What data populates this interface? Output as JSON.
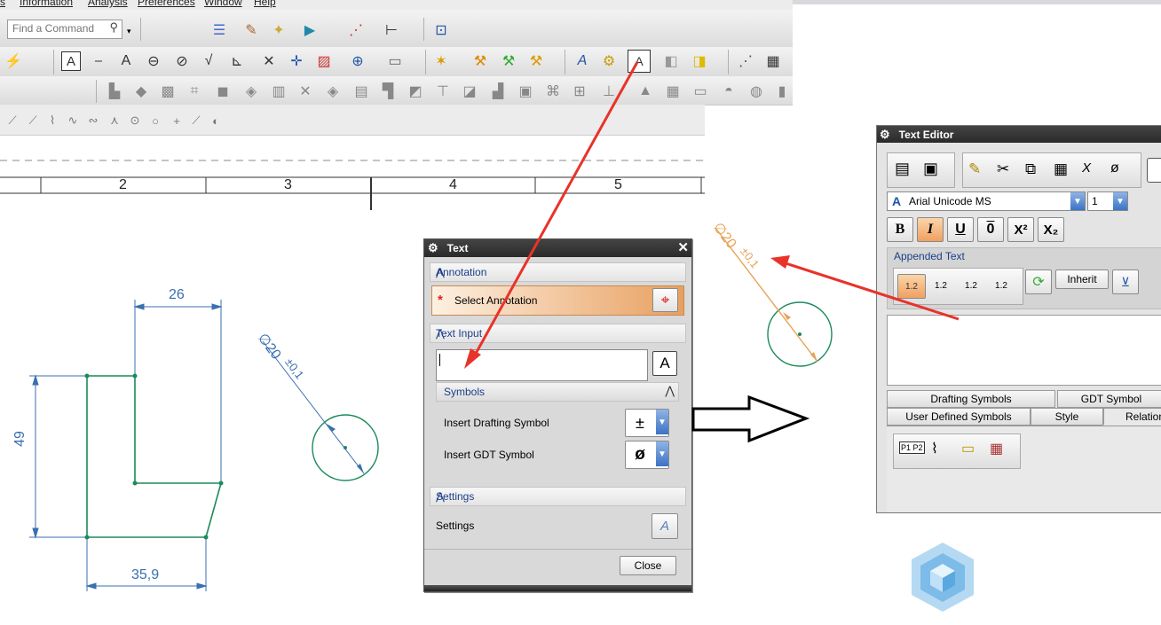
{
  "menu": {
    "items": [
      "s",
      "Information",
      "Analysis",
      "Preferences",
      "Window",
      "Help"
    ]
  },
  "search": {
    "placeholder": "Find a Command"
  },
  "ruler": {
    "numbers": [
      "2",
      "3",
      "4",
      "5"
    ]
  },
  "drawing": {
    "dim_top": "26",
    "dim_left": "49",
    "dim_bottom": "35,9",
    "note_diameter": "∅20",
    "note_tolerance": "±0,1"
  },
  "text_dialog": {
    "title": "Text",
    "sections": {
      "annotation": "Annotation",
      "select_annotation": "Select Annotation",
      "text_input": "Text Input",
      "symbols": "Symbols",
      "insert_drafting_symbol": "Insert Drafting Symbol",
      "insert_gdt_symbol": "Insert GDT Symbol",
      "settings_header": "Settings",
      "settings_label": "Settings"
    },
    "text_value": "",
    "drafting_symbol_value": "±",
    "gdt_symbol_value": "ø",
    "close_label": "Close"
  },
  "text_editor": {
    "title": "Text Editor",
    "font_name": "Arial Unicode MS",
    "font_size": "1",
    "format_buttons": {
      "bold": "B",
      "italic": "I",
      "underline": "U",
      "overline": "0",
      "superscript": "X²",
      "subscript": "X₂"
    },
    "appended_text_label": "Appended Text",
    "appended_buttons": [
      "1.2",
      "1.2",
      "1.2",
      "1.2"
    ],
    "inherit_label": "Inherit",
    "tabs_row1": [
      "Drafting Symbols",
      "GDT Symbol"
    ],
    "tabs_row2": [
      "User Defined Symbols",
      "Style",
      "Relation"
    ]
  },
  "colors": {
    "annotation_orange": "#e8a256",
    "arrow_red": "#e8332a",
    "dimension_blue": "#3a6fb0",
    "geometry_green": "#1b8a5a",
    "dialog_header_blue": "#1b3f8a"
  }
}
